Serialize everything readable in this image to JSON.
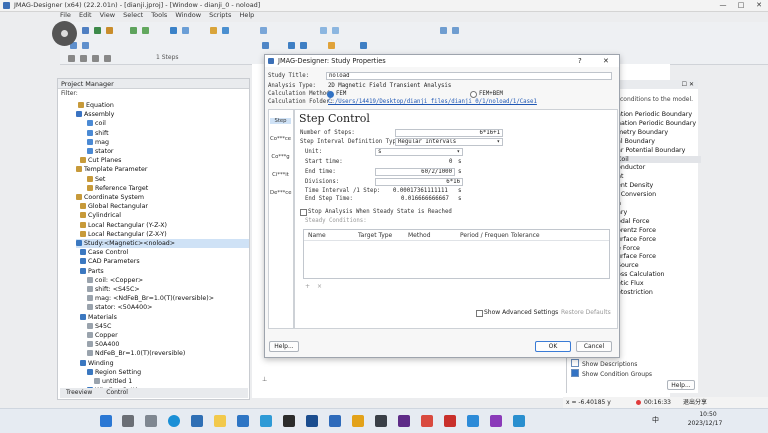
{
  "window": {
    "title": "JMAG-Designer (x64) (22.2.01n) - [dianji.jproj] - [Window - dianji_0 - noload]",
    "minimize": "—",
    "maximize": "□",
    "close": "✕"
  },
  "menu": [
    "File",
    "Edit",
    "View",
    "Select",
    "Tools",
    "Window",
    "Scripts",
    "Help"
  ],
  "toolbar": {
    "steps_label": "1 Steps"
  },
  "project_manager": {
    "title": "Project Manager",
    "filter_label": "Filter:",
    "tree": [
      "Equation",
      "Assembly",
      "coil",
      "shift",
      "mag",
      "stator",
      "Cut Planes",
      "Template Parameter",
      "Set",
      "Reference Target",
      "Coordinate System",
      "Global Rectangular",
      "Cylindrical",
      "Local Rectangular (Y-Z-X)",
      "Local Rectangular (Z-X-Y)",
      "Study:<Magnetic><noload>",
      "Case Control",
      "CAD Parameters",
      "Parts",
      "coil: <Copper>",
      "shift: <S45C>",
      "mag: <NdFeB_Br=1.0(T)(reversible)>",
      "stator: <50A400>",
      "Materials",
      "S45C",
      "Copper",
      "50A400",
      "NdFeB_Br=1.0(T)(reversible)",
      "Winding",
      "Region Setting",
      "untitled 1",
      "Winding Setting"
    ],
    "tabs": [
      "Treeview",
      "Control"
    ]
  },
  "right_panel": {
    "hint": "conditions to the model.",
    "items": [
      "ation Periodic Boundary",
      "nation Periodic Boundary",
      "metry Boundary",
      "al Boundary",
      "ar Potential Boundary",
      "Coil",
      "onductor",
      "nt",
      "ent Density",
      "l Conversion",
      "n",
      "ary",
      "odal Force",
      "orentz Force",
      "urface Force",
      "e Force",
      "urface Force",
      "Source",
      "oss Calculation",
      "etic Flux",
      "etostriction"
    ],
    "show_descriptions": "Show Descriptions",
    "show_condition_groups": "Show Condition Groups",
    "help_button": "Help..."
  },
  "dialog": {
    "title": "JMAG-Designer: Study Properties",
    "help_q": "?",
    "close": "✕",
    "study_title_label": "Study Title:",
    "study_title_value": "noload",
    "analysis_type_label": "Analysis Type:",
    "analysis_type_value": "2D Magnetic Field Transient Analysis",
    "calc_method_label": "Calculation Method:",
    "calc_method_fem": "FEM",
    "calc_method_femben": "FEM+BEM",
    "calc_folder_label": "Calculation Folder:",
    "calc_folder_value": "C:/Users/14419/Desktop/dianji_files/dianji_0/1/noload/1/Case1",
    "sidebar": [
      "Step",
      "Co***ce",
      "Co***g",
      "Ci***it",
      "De***ce"
    ],
    "section_title": "Step Control",
    "num_steps_label": "Number of Steps:",
    "num_steps_value": "6*16+1",
    "interval_type_label": "Step Interval Definition Type:",
    "interval_type_value": "Regular Intervals",
    "unit_label": "Unit:",
    "unit_value": "s",
    "start_time_label": "Start time:",
    "start_time_value": "0",
    "start_time_unit": "s",
    "end_time_label": "End time:",
    "end_time_value": "60/2/1000",
    "end_time_unit": "s",
    "divisions_label": "Divisions:",
    "divisions_value": "6*16",
    "time_interval_label": "Time Interval /1 Step:",
    "time_interval_value": "0.00017361111111",
    "time_interval_unit": "s",
    "end_step_label": "End Step Time:",
    "end_step_value": "0.016666666667",
    "end_step_unit": "s",
    "stop_steady_label": "Stop Analysis When Steady State is Reached",
    "steady_conditions_label": "Steady Conditions:",
    "table_headers": [
      "Name",
      "Target Type",
      "Method",
      "Period / Frequen",
      "Tolerance"
    ],
    "add_btn": "+",
    "remove_btn": "×",
    "show_advanced": "Show Advanced Settings",
    "restore_defaults": "Restore Defaults",
    "help_btn": "Help...",
    "ok_btn": "OK",
    "cancel_btn": "Cancel"
  },
  "status": {
    "coord": "x = -6.40185 y",
    "timer": "00:16:33",
    "share_exit": "退出分享"
  },
  "taskbar": {
    "time": "10:50",
    "date": "2023/12/17",
    "lang": "中"
  },
  "colors": {
    "accent": "#3373c4",
    "selection": "#cfe2f6",
    "link": "#1f57b4"
  }
}
